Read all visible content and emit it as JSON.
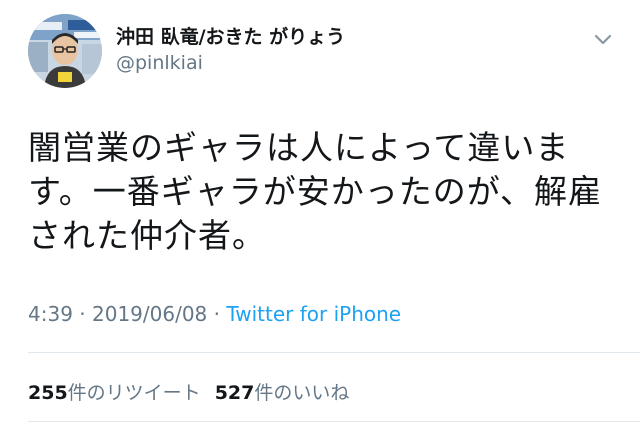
{
  "tweet": {
    "author": {
      "display_name": "沖田 臥竜/おきた がりょう",
      "handle": "@pinlkiai"
    },
    "text_lines": [
      "闇営業のギャラは人によって違いま",
      "す。一番ギャラが安かったのが、解雇",
      "された仲介者。"
    ],
    "time": "4:39",
    "date": "2019/06/08",
    "separator": "·",
    "source": "Twitter for iPhone",
    "retweets": {
      "count": "255",
      "label": "件のリツイート"
    },
    "likes": {
      "count": "527",
      "label": "件のいいね"
    }
  },
  "icons": {
    "menu": "chevron-down-icon",
    "avatar": "profile-photo"
  },
  "colors": {
    "text": "#14171a",
    "secondary": "#657786",
    "link": "#1da1f2",
    "divider": "#e1e8ed"
  }
}
